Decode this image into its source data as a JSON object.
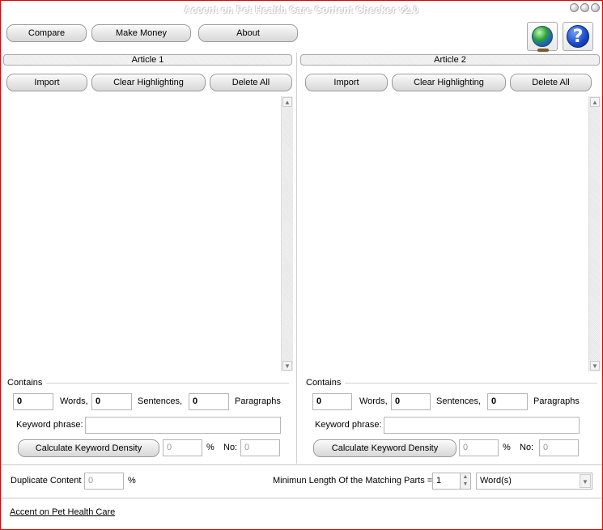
{
  "window": {
    "title": "Accent on Pet Health Care Content Checker v2.0"
  },
  "toolbar": {
    "compare_label": "Compare",
    "make_money_label": "Make Money",
    "about_label": "About",
    "globe_icon": "globe-icon",
    "help_icon": "help-icon",
    "help_glyph": "?"
  },
  "article1": {
    "header": "Article 1",
    "import_label": "Import",
    "clear_label": "Clear Highlighting",
    "delete_label": "Delete All",
    "contains_label": "Contains",
    "words_value": "0",
    "words_label": "Words,",
    "sentences_value": "0",
    "sentences_label": "Sentences,",
    "paragraphs_value": "0",
    "paragraphs_label": "Paragraphs",
    "keyword_label": "Keyword phrase:",
    "keyword_value": "",
    "calc_label": "Calculate Keyword Density",
    "density_value": "0",
    "percent_label": "%",
    "no_label": "No:",
    "no_value": "0"
  },
  "article2": {
    "header": "Article 2",
    "import_label": "Import",
    "clear_label": "Clear Highlighting",
    "delete_label": "Delete All",
    "contains_label": "Contains",
    "words_value": "0",
    "words_label": "Words,",
    "sentences_value": "0",
    "sentences_label": "Sentences,",
    "paragraphs_value": "0",
    "paragraphs_label": "Paragraphs",
    "keyword_label": "Keyword phrase:",
    "keyword_value": "",
    "calc_label": "Calculate Keyword Density",
    "density_value": "0",
    "percent_label": "%",
    "no_label": "No:",
    "no_value": "0"
  },
  "bottom": {
    "duplicate_label": "Duplicate Content",
    "duplicate_value": "0",
    "duplicate_percent": "%",
    "min_length_label": "Minimun Length Of the Matching Parts =",
    "min_length_value": "1",
    "unit_selected": "Word(s)"
  },
  "footer": {
    "link_text": "Accent on Pet Health Care"
  },
  "colors": {
    "window_border": "#e00000",
    "help_blue": "#1447c6"
  }
}
